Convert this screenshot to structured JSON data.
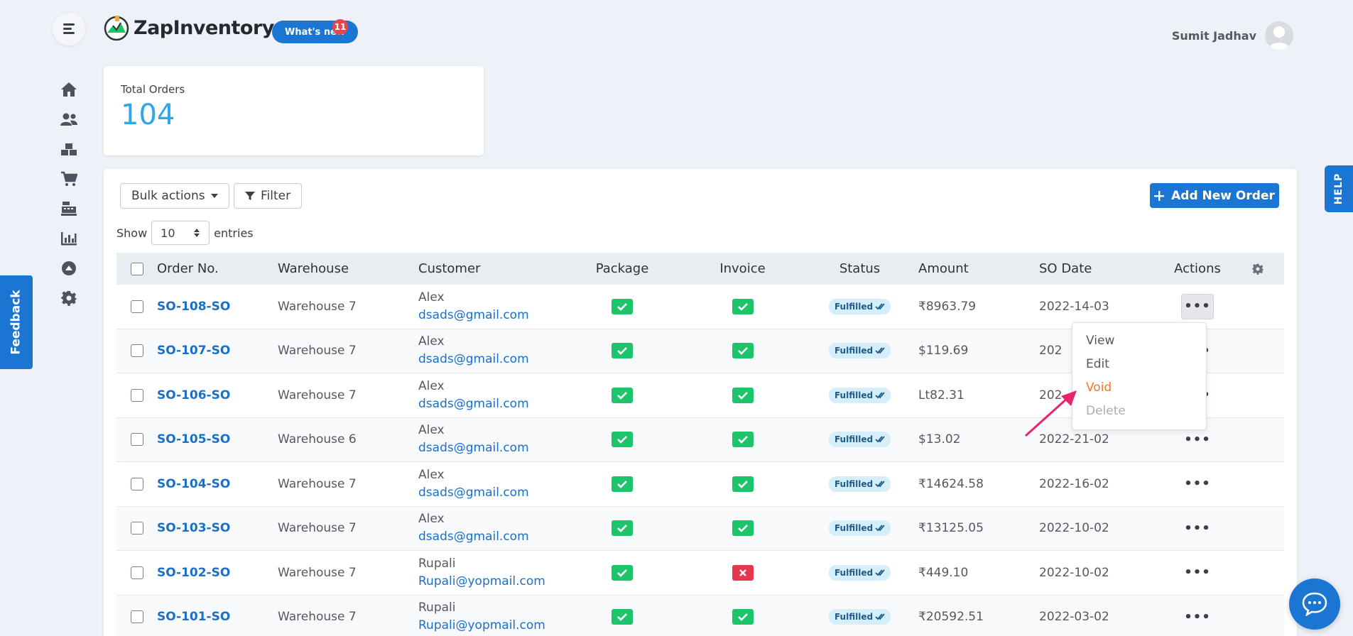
{
  "header": {
    "brand": "ZapInventory",
    "whats_new": "What's new",
    "whats_new_count": "11",
    "user_name": "Sumit Jadhav"
  },
  "sidebar": {
    "items": [
      {
        "icon": "home-icon"
      },
      {
        "icon": "users-icon"
      },
      {
        "icon": "boxes-icon"
      },
      {
        "icon": "cart-icon"
      },
      {
        "icon": "cash-register-icon"
      },
      {
        "icon": "chart-icon"
      },
      {
        "icon": "arrow-up-circle-icon"
      },
      {
        "icon": "gear-icon"
      }
    ]
  },
  "feedback_label": "Feedback",
  "help_label": "HELP",
  "stats": {
    "total_orders_label": "Total Orders",
    "total_orders_value": "104"
  },
  "toolbar": {
    "bulk_actions": "Bulk actions",
    "filter": "Filter",
    "add_new_order": "Add New Order",
    "show": "Show",
    "entries_value": "10",
    "entries": "entries"
  },
  "table": {
    "headers": {
      "order_no": "Order No.",
      "warehouse": "Warehouse",
      "customer": "Customer",
      "package": "Package",
      "invoice": "Invoice",
      "status": "Status",
      "amount": "Amount",
      "so_date": "SO Date",
      "actions": "Actions"
    },
    "rows": [
      {
        "order": "SO-108-SO",
        "warehouse": "Warehouse 7",
        "name": "Alex",
        "email": "dsads@gmail.com",
        "package": "ok",
        "invoice": "ok",
        "status": "Fulfilled",
        "amount": "₹8963.79",
        "date": "2022-14-03"
      },
      {
        "order": "SO-107-SO",
        "warehouse": "Warehouse 7",
        "name": "Alex",
        "email": "dsads@gmail.com",
        "package": "ok",
        "invoice": "ok",
        "status": "Fulfilled",
        "amount": "$119.69",
        "date": "202"
      },
      {
        "order": "SO-106-SO",
        "warehouse": "Warehouse 7",
        "name": "Alex",
        "email": "dsads@gmail.com",
        "package": "ok",
        "invoice": "ok",
        "status": "Fulfilled",
        "amount": "Lt82.31",
        "date": "202"
      },
      {
        "order": "SO-105-SO",
        "warehouse": "Warehouse 6",
        "name": "Alex",
        "email": "dsads@gmail.com",
        "package": "ok",
        "invoice": "ok",
        "status": "Fulfilled",
        "amount": "$13.02",
        "date": "2022-21-02"
      },
      {
        "order": "SO-104-SO",
        "warehouse": "Warehouse 7",
        "name": "Alex",
        "email": "dsads@gmail.com",
        "package": "ok",
        "invoice": "ok",
        "status": "Fulfilled",
        "amount": "₹14624.58",
        "date": "2022-16-02"
      },
      {
        "order": "SO-103-SO",
        "warehouse": "Warehouse 7",
        "name": "Alex",
        "email": "dsads@gmail.com",
        "package": "ok",
        "invoice": "ok",
        "status": "Fulfilled",
        "amount": "₹13125.05",
        "date": "2022-10-02"
      },
      {
        "order": "SO-102-SO",
        "warehouse": "Warehouse 7",
        "name": "Rupali",
        "email": "Rupali@yopmail.com",
        "package": "ok",
        "invoice": "fail",
        "status": "Fulfilled",
        "amount": "₹449.10",
        "date": "2022-10-02"
      },
      {
        "order": "SO-101-SO",
        "warehouse": "Warehouse 7",
        "name": "Rupali",
        "email": "Rupali@yopmail.com",
        "package": "ok",
        "invoice": "ok",
        "status": "Fulfilled",
        "amount": "₹20592.51",
        "date": "2022-03-02"
      }
    ]
  },
  "dropdown": {
    "items": [
      "View",
      "Edit",
      "Void",
      "Delete"
    ]
  },
  "colors": {
    "primary": "#1a76d2",
    "accent_number": "#2ea6e8",
    "success": "#1ec46a",
    "danger": "#e5384f",
    "void": "#f2762d",
    "arrow": "#e8246e"
  }
}
